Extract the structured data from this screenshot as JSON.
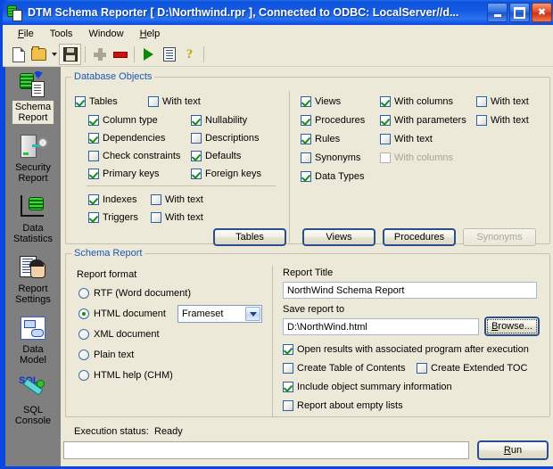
{
  "window": {
    "title": "DTM Schema Reporter [ D:\\Northwind.rpr ], Connected to ODBC: LocalServer//d...",
    "app_icon": "database-report-icon",
    "minimize_label": "Minimize",
    "maximize_label": "Maximize",
    "close_label": "Close"
  },
  "menubar": {
    "items": [
      {
        "label": "File",
        "accel": "F"
      },
      {
        "label": "Tools",
        "accel": "T"
      },
      {
        "label": "Window",
        "accel": "W"
      },
      {
        "label": "Help",
        "accel": "H"
      }
    ]
  },
  "toolbar": {
    "buttons": [
      {
        "name": "new-icon",
        "tooltip": "New"
      },
      {
        "name": "open-folder-icon",
        "tooltip": "Open"
      },
      {
        "name": "open-dropdown-arrow-icon",
        "tooltip": "Recent files"
      },
      {
        "name": "save-icon",
        "tooltip": "Save"
      },
      {
        "name": "add-plus-icon",
        "tooltip": "Add"
      },
      {
        "name": "remove-minus-icon",
        "tooltip": "Remove"
      },
      {
        "name": "run-play-icon",
        "tooltip": "Run"
      },
      {
        "name": "log-list-icon",
        "tooltip": "Log"
      },
      {
        "name": "help-question-icon",
        "tooltip": "Help"
      }
    ]
  },
  "sidebar": {
    "items": [
      {
        "label": "Schema\nReport",
        "icon": "schema-report-icon",
        "selected": true
      },
      {
        "label": "Security\nReport",
        "icon": "security-report-icon",
        "selected": false
      },
      {
        "label": "Data\nStatistics",
        "icon": "data-statistics-icon",
        "selected": false
      },
      {
        "label": "Report\nSettings",
        "icon": "report-settings-icon",
        "selected": false
      },
      {
        "label": "Data\nModel",
        "icon": "data-model-icon",
        "selected": false
      },
      {
        "label": "SQL\nConsole",
        "icon": "sql-console-icon",
        "selected": false
      }
    ]
  },
  "database_objects": {
    "legend": "Database Objects",
    "left_column": {
      "tables": {
        "label": "Tables",
        "checked": true
      },
      "tables_with_text": {
        "label": "With text",
        "checked": false
      },
      "column_type": {
        "label": "Column type",
        "checked": true
      },
      "nullability": {
        "label": "Nullability",
        "checked": true
      },
      "dependencies": {
        "label": "Dependencies",
        "checked": true
      },
      "descriptions": {
        "label": "Descriptions",
        "checked": false
      },
      "check_constraints": {
        "label": "Check constraints",
        "checked": false
      },
      "defaults": {
        "label": "Defaults",
        "checked": true
      },
      "primary_keys": {
        "label": "Primary keys",
        "checked": true
      },
      "foreign_keys": {
        "label": "Foreign keys",
        "checked": true
      },
      "indexes": {
        "label": "Indexes",
        "checked": true
      },
      "indexes_with_text": {
        "label": "With text",
        "checked": false
      },
      "triggers": {
        "label": "Triggers",
        "checked": true
      },
      "triggers_with_text": {
        "label": "With text",
        "checked": false
      },
      "tables_button": {
        "label": "Tables"
      }
    },
    "right_column": {
      "views": {
        "label": "Views",
        "checked": true
      },
      "views_with_columns": {
        "label": "With columns",
        "checked": true
      },
      "views_with_text": {
        "label": "With text",
        "checked": false
      },
      "procedures": {
        "label": "Procedures",
        "checked": true
      },
      "procedures_with_parameters": {
        "label": "With parameters",
        "checked": true
      },
      "procedures_with_text": {
        "label": "With text",
        "checked": false
      },
      "rules": {
        "label": "Rules",
        "checked": true
      },
      "rules_with_text": {
        "label": "With text",
        "checked": false
      },
      "synonyms": {
        "label": "Synonyms",
        "checked": false
      },
      "synonyms_with_columns": {
        "label": "With columns",
        "checked": false,
        "disabled": true
      },
      "data_types": {
        "label": "Data Types",
        "checked": true
      },
      "views_button": {
        "label": "Views"
      },
      "procedures_button": {
        "label": "Procedures"
      },
      "synonyms_button": {
        "label": "Synonyms",
        "disabled": true
      }
    }
  },
  "schema_report": {
    "legend": "Schema Report",
    "report_format": {
      "label": "Report format",
      "options": [
        {
          "label": "RTF (Word document)",
          "selected": false
        },
        {
          "label": "HTML document",
          "selected": true
        },
        {
          "label": "XML document",
          "selected": false
        },
        {
          "label": "Plain text",
          "selected": false
        },
        {
          "label": "HTML help (CHM)",
          "selected": false
        }
      ],
      "html_style_combo": {
        "value": "Frameset"
      }
    },
    "report_title": {
      "label": "Report Title",
      "value": "NorthWind Schema Report"
    },
    "save_report_to": {
      "label": "Save report to",
      "value": "D:\\NorthWind.html",
      "browse_label": "Browse...",
      "browse_accel": "B"
    },
    "options": [
      {
        "label": "Open results with associated program after execution",
        "checked": true
      },
      {
        "label": "Create Table of Contents",
        "checked": false
      },
      {
        "label": "Create Extended TOC",
        "checked": false
      },
      {
        "label": "Include object summary information",
        "checked": true
      },
      {
        "label": "Report about empty lists",
        "checked": false
      }
    ]
  },
  "status": {
    "label": "Execution status:",
    "value": "Ready",
    "progress_value": "",
    "run_button": {
      "label": "Run",
      "accel": "R"
    }
  },
  "colors": {
    "window_frame": "#0a46e0",
    "titlebar_gradient_start": "#1f6cea",
    "panel_background": "#ece9d8",
    "group_legend": "#1a57b5",
    "sidebar_background": "#7f7f7f",
    "checkmark_green": "#1a8a1a",
    "close_button_red": "#e1502a"
  }
}
